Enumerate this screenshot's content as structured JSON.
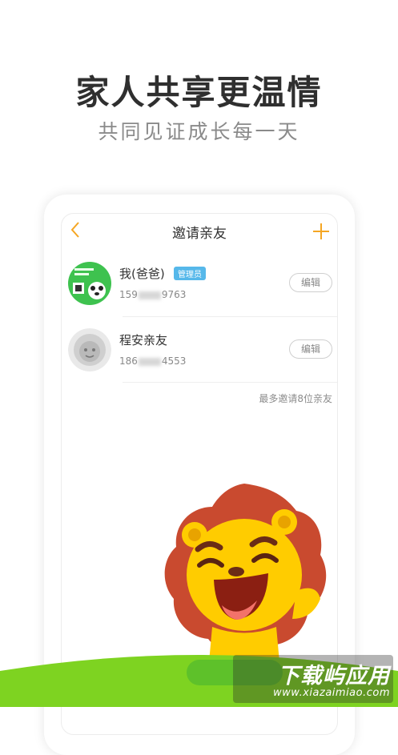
{
  "hero": {
    "title": "家人共享更温情",
    "subtitle": "共同见证成长每一天"
  },
  "nav": {
    "title": "邀请亲友"
  },
  "members": [
    {
      "name": "我(爸爸)",
      "badge": "管理员",
      "phone_prefix": "159",
      "phone_suffix": "9763",
      "edit_label": "编辑"
    },
    {
      "name": "程安亲友",
      "badge": "",
      "phone_prefix": "186",
      "phone_suffix": "4553",
      "edit_label": "编辑"
    }
  ],
  "invite_limit": "最多邀请8位亲友",
  "watermark": {
    "text": "下载屿应用",
    "url": "www.xiazaimiao.com"
  },
  "colors": {
    "accent": "#f5a623",
    "badge": "#56b8ea",
    "grass": "#7ed321"
  }
}
